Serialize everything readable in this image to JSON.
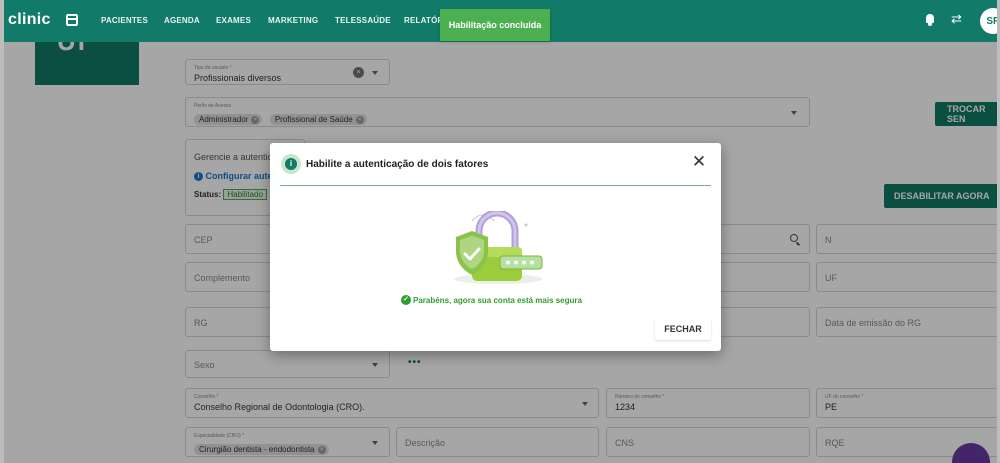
{
  "app": {
    "logo": "clinic"
  },
  "nav": {
    "items": [
      "PACIENTES",
      "AGENDA",
      "EXAMES",
      "MARKETING",
      "TELESSAÚDE",
      "RELATÓRI"
    ],
    "avatar_initials": "SP"
  },
  "toast": {
    "text": "Habilitação concluída"
  },
  "profile": {
    "photo_initials": "UI"
  },
  "form": {
    "tipo_usuario": {
      "label": "Tipo de usuário *",
      "value": "Profissionais diversos"
    },
    "perfis_acesso": {
      "label": "Perfis de Acesso",
      "chips": [
        "Administrador",
        "Profissional de Saúde"
      ]
    },
    "trocar_senha": "TROCAR SEN",
    "twofa": {
      "text": "Gerencie a autentic",
      "link": "Configurar aute",
      "status_label": "Status:",
      "status_value": "Habilitado"
    },
    "desabilitar": "DESABILITAR AGORA",
    "cep": "CEP",
    "numero": "N",
    "complemento": "Complemento",
    "uf": "UF",
    "rg": "RG",
    "data_emissao_rg": "Data de emissão do RG",
    "sexo": "Sexo",
    "conselho": {
      "label": "Conselho *",
      "value": "Conselho Regional de Odontologia (CRO)."
    },
    "numero_conselho": {
      "label": "Número do conselho *",
      "value": "1234"
    },
    "uf_conselho": {
      "label": "UF do conselho *",
      "value": "PE"
    },
    "especialidade": {
      "label": "Especialidade (CBO) *",
      "chip": "Cirurgião dentista - endodontista"
    },
    "descricao": "Descrição",
    "cns": "CNS",
    "rqe": "RQE"
  },
  "modal": {
    "title": "Habilite a autenticação de dois fatores",
    "success": "Parabéns, agora sua conta está mais segura",
    "close_button": "FECHAR"
  },
  "colors": {
    "primary": "#127a68",
    "toast": "#4caf50",
    "success": "#2e9e2e",
    "fab": "#6a3aa2"
  }
}
